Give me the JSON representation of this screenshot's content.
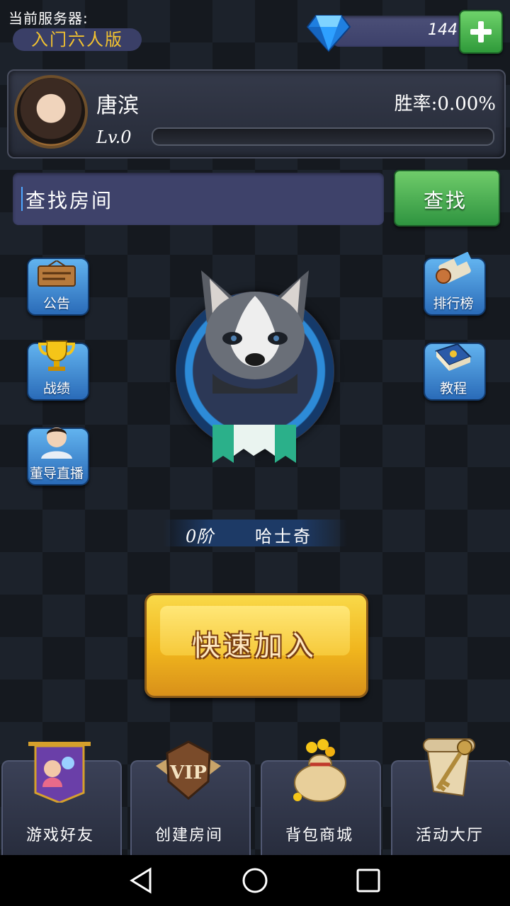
{
  "server": {
    "label": "当前服务器:",
    "name": "入门六人版"
  },
  "currency": {
    "gems": "144",
    "gem_icon": "diamond-icon",
    "add_icon": "plus-icon"
  },
  "player": {
    "name": "唐滨",
    "win_rate": "胜率:0.00%",
    "level": "Lv.0",
    "xp_progress": 0
  },
  "search": {
    "placeholder": "查找房间",
    "button": "查找"
  },
  "side_menu": {
    "left": [
      {
        "label": "公告",
        "icon": "notice-board-icon"
      },
      {
        "label": "战绩",
        "icon": "trophy-icon"
      },
      {
        "label": "董导直播",
        "icon": "streamer-avatar-icon"
      }
    ],
    "right": [
      {
        "label": "排行榜",
        "icon": "scroll-icon"
      },
      {
        "label": "教程",
        "icon": "book-icon"
      }
    ]
  },
  "rank": {
    "tier": "0阶",
    "name": "哈士奇"
  },
  "quick_join": {
    "label": "快速加入"
  },
  "tabs": [
    {
      "label": "游戏好友",
      "icon": "friends-banner-icon"
    },
    {
      "label": "创建房间",
      "icon": "vip-badge-icon"
    },
    {
      "label": "背包商城",
      "icon": "money-bag-icon"
    },
    {
      "label": "活动大厅",
      "icon": "key-scroll-icon"
    }
  ],
  "nav": {
    "back": "back-icon",
    "home": "home-icon",
    "recents": "recents-icon"
  },
  "colors": {
    "server_name": "#f2c230",
    "green_button": "#2f9440",
    "side_button": "#2a6bb8",
    "quick_join": "#f0b51d"
  }
}
